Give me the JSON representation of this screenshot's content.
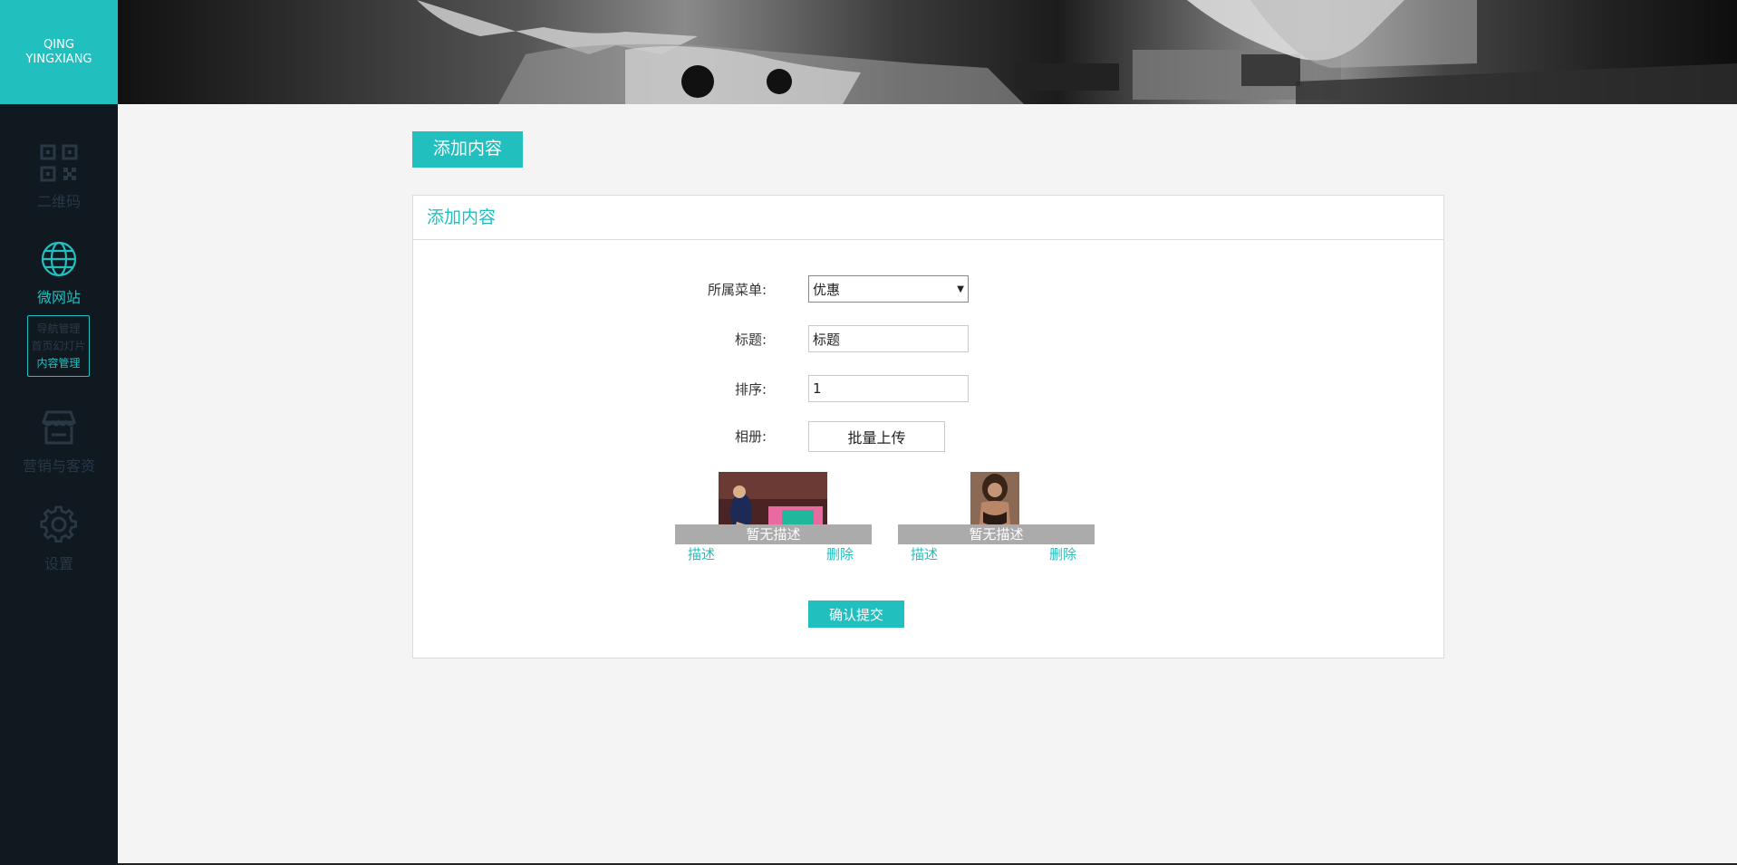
{
  "brand": {
    "line1": "QING",
    "line2": "YINGXIANG"
  },
  "sidebar": {
    "items": [
      {
        "label": "二维码",
        "icon": "qr-code-icon",
        "active": false
      },
      {
        "label": "微网站",
        "icon": "globe-icon",
        "active": true
      },
      {
        "label": "营销与客资",
        "icon": "store-icon",
        "active": false
      },
      {
        "label": "设置",
        "icon": "gear-icon",
        "active": false
      }
    ],
    "submenu": [
      "导航管理",
      "首页幻灯片",
      "内容管理"
    ]
  },
  "colors": {
    "accent": "#22bfbf",
    "sidebar": "#101820",
    "background": "#f4f4f4"
  },
  "page": {
    "action_button": "添加内容"
  },
  "panel": {
    "title": "添加内容"
  },
  "form": {
    "menu": {
      "label": "所属菜单:",
      "value": "优惠"
    },
    "title": {
      "label": "标题:",
      "value": "标题"
    },
    "order": {
      "label": "排序:",
      "value": "1"
    },
    "album": {
      "label": "相册:",
      "upload_button": "批量上传"
    },
    "photos": [
      {
        "caption": "暂无描述",
        "describe": "描述",
        "delete": "删除"
      },
      {
        "caption": "暂无描述",
        "describe": "描述",
        "delete": "删除"
      }
    ],
    "submit": "确认提交"
  }
}
